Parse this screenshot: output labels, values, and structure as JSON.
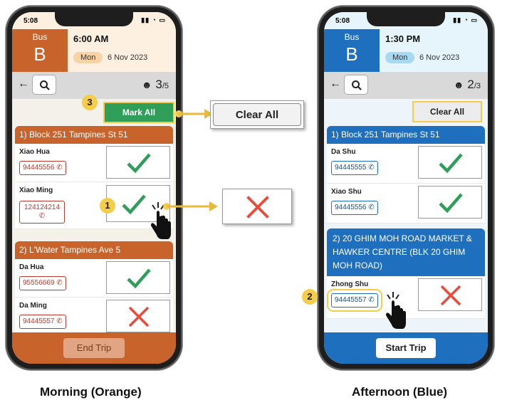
{
  "morning": {
    "status_time": "5:08",
    "bus_label": "Bus",
    "bus_letter": "B",
    "time": "6:00 AM",
    "day": "Mon",
    "date": "6 Nov 2023",
    "count": "3",
    "total": "/5",
    "mark_all": "Mark All",
    "sections": [
      {
        "title": "1) Block 251 Tampines St 51",
        "rows": [
          {
            "name": "Xiao Hua",
            "phone": "94445556",
            "status": "check"
          },
          {
            "name": "Xiao Ming",
            "phone": "124124214",
            "status": "check"
          }
        ]
      },
      {
        "title": "2) L'Water Tampines Ave 5",
        "rows": [
          {
            "name": "Da Hua",
            "phone": "95556669",
            "status": "check"
          },
          {
            "name": "Da Ming",
            "phone": "94445557",
            "status": "cross"
          }
        ]
      }
    ],
    "footer_button": "End Trip",
    "colors": {
      "primary": "#c8632c",
      "light": "#fdf0e0",
      "pill": "#f9d3a5",
      "green": "#2e9e58"
    }
  },
  "afternoon": {
    "status_time": "5:08",
    "bus_label": "Bus",
    "bus_letter": "B",
    "time": "1:30 PM",
    "day": "Mon",
    "date": "6 Nov 2023",
    "count": "2",
    "total": "/3",
    "clear_all": "Clear All",
    "sections": [
      {
        "title": "1) Block 251 Tampines St 51",
        "rows": [
          {
            "name": "Da Shu",
            "phone": "94445555",
            "status": "check"
          },
          {
            "name": "Xiao Shu",
            "phone": "94445556",
            "status": "check"
          }
        ]
      },
      {
        "title": "2) 20 GHIM MOH ROAD MARKET & HAWKER CENTRE (BLK 20 GHIM MOH ROAD)",
        "rows": [
          {
            "name": "Zhong Shu",
            "phone": "94445557",
            "status": "cross"
          }
        ]
      }
    ],
    "footer_button": "Start Trip",
    "colors": {
      "primary": "#1f6fbf",
      "light": "#e6f4fc",
      "pill": "#a8d8f2"
    }
  },
  "callouts": {
    "clear_all": "Clear All",
    "badges": [
      "1",
      "2",
      "3"
    ]
  },
  "captions": {
    "left": "Morning (Orange)",
    "right": "Afternoon (Blue)"
  }
}
